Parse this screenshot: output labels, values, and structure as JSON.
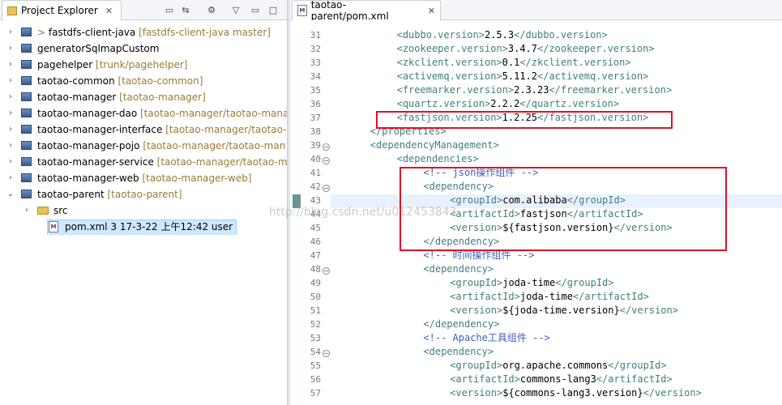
{
  "left_panel": {
    "tab_title": "Project Explorer",
    "items": [
      {
        "label": "fastdfs-client-java",
        "decoration": "[fastdfs-client-java master]",
        "prefix": ">",
        "type": "project",
        "expanded": false
      },
      {
        "label": "generatorSqlmapCustom",
        "decoration": "",
        "prefix": "",
        "type": "project",
        "expanded": false
      },
      {
        "label": "pagehelper",
        "decoration": "[trunk/pagehelper]",
        "prefix": "",
        "type": "project",
        "expanded": false
      },
      {
        "label": "taotao-common",
        "decoration": "[taotao-common]",
        "prefix": "",
        "type": "project",
        "expanded": false
      },
      {
        "label": "taotao-manager",
        "decoration": "[taotao-manager]",
        "prefix": "",
        "type": "project",
        "expanded": false
      },
      {
        "label": "taotao-manager-dao",
        "decoration": "[taotao-manager/taotao-mana",
        "prefix": "",
        "type": "project",
        "expanded": false
      },
      {
        "label": "taotao-manager-interface",
        "decoration": "[taotao-manager/taotao-m",
        "prefix": "",
        "type": "project",
        "expanded": false
      },
      {
        "label": "taotao-manager-pojo",
        "decoration": "[taotao-manager/taotao-man",
        "prefix": "",
        "type": "project",
        "expanded": false
      },
      {
        "label": "taotao-manager-service",
        "decoration": "[taotao-manager/taotao-m",
        "prefix": "",
        "type": "project",
        "expanded": false
      },
      {
        "label": "taotao-manager-web",
        "decoration": "[taotao-manager-web]",
        "prefix": "",
        "type": "project",
        "expanded": false
      },
      {
        "label": "taotao-parent",
        "decoration": "[taotao-parent]",
        "prefix": "",
        "type": "project",
        "expanded": true
      },
      {
        "label": "src",
        "decoration": "",
        "prefix": "",
        "type": "folder",
        "expanded": false
      },
      {
        "label": "pom.xml 3  17-3-22 上午12:42  user",
        "decoration": "",
        "prefix": "",
        "type": "xml",
        "selected": true
      }
    ]
  },
  "editor": {
    "tab_title": "taotao-parent/pom.xml",
    "current_line": 43,
    "lines": [
      {
        "n": "31",
        "indent": 8,
        "parts": [
          [
            "t",
            "<dubbo.version>"
          ],
          [
            "v",
            "2.5.3"
          ],
          [
            "t",
            "</dubbo.version>"
          ]
        ]
      },
      {
        "n": "32",
        "indent": 8,
        "parts": [
          [
            "t",
            "<zookeeper.version>"
          ],
          [
            "v",
            "3.4.7"
          ],
          [
            "t",
            "</zookeeper.version>"
          ]
        ]
      },
      {
        "n": "33",
        "indent": 8,
        "parts": [
          [
            "t",
            "<zkclient.version>"
          ],
          [
            "v",
            "0.1"
          ],
          [
            "t",
            "</zkclient.version>"
          ]
        ]
      },
      {
        "n": "34",
        "indent": 8,
        "parts": [
          [
            "t",
            "<activemq.version>"
          ],
          [
            "v",
            "5.11.2"
          ],
          [
            "t",
            "</activemq.version>"
          ]
        ]
      },
      {
        "n": "35",
        "indent": 8,
        "parts": [
          [
            "t",
            "<freemarker.version>"
          ],
          [
            "v",
            "2.3.23"
          ],
          [
            "t",
            "</freemarker.version>"
          ]
        ]
      },
      {
        "n": "36",
        "indent": 8,
        "parts": [
          [
            "t",
            "<quartz.version>"
          ],
          [
            "v",
            "2.2.2"
          ],
          [
            "t",
            "</quartz.version>"
          ]
        ]
      },
      {
        "n": "37",
        "indent": 8,
        "parts": [
          [
            "t",
            "<fastjson.version>"
          ],
          [
            "v",
            "1.2.25"
          ],
          [
            "t",
            "</fastjson.version>"
          ]
        ]
      },
      {
        "n": "38",
        "indent": 4,
        "parts": [
          [
            "t",
            "</properties>"
          ]
        ]
      },
      {
        "n": "39",
        "indent": 4,
        "fold": true,
        "parts": [
          [
            "t",
            "<dependencyManagement>"
          ]
        ]
      },
      {
        "n": "40",
        "indent": 8,
        "fold": true,
        "parts": [
          [
            "t",
            "<dependencies>"
          ]
        ]
      },
      {
        "n": "41",
        "indent": 12,
        "parts": [
          [
            "c",
            "<!-- json操作组件 -->"
          ]
        ]
      },
      {
        "n": "42",
        "indent": 12,
        "fold": true,
        "parts": [
          [
            "t",
            "<dependency>"
          ]
        ]
      },
      {
        "n": "43",
        "indent": 16,
        "parts": [
          [
            "t",
            "<groupId>"
          ],
          [
            "v",
            "com.alibaba"
          ],
          [
            "t",
            "</groupId>"
          ]
        ]
      },
      {
        "n": "44",
        "indent": 16,
        "parts": [
          [
            "t",
            "<artifactId>"
          ],
          [
            "v",
            "fastjson"
          ],
          [
            "t",
            "</artifactId>"
          ]
        ]
      },
      {
        "n": "45",
        "indent": 16,
        "parts": [
          [
            "t",
            "<version>"
          ],
          [
            "v",
            "${fastjson.version}"
          ],
          [
            "t",
            "</version>"
          ]
        ]
      },
      {
        "n": "46",
        "indent": 12,
        "parts": [
          [
            "t",
            "</dependency>"
          ]
        ]
      },
      {
        "n": "47",
        "indent": 12,
        "parts": [
          [
            "c",
            "<!-- 时间操作组件 -->"
          ]
        ]
      },
      {
        "n": "48",
        "indent": 12,
        "fold": true,
        "parts": [
          [
            "t",
            "<dependency>"
          ]
        ]
      },
      {
        "n": "49",
        "indent": 16,
        "parts": [
          [
            "t",
            "<groupId>"
          ],
          [
            "v",
            "joda-time"
          ],
          [
            "t",
            "</groupId>"
          ]
        ]
      },
      {
        "n": "50",
        "indent": 16,
        "parts": [
          [
            "t",
            "<artifactId>"
          ],
          [
            "v",
            "joda-time"
          ],
          [
            "t",
            "</artifactId>"
          ]
        ]
      },
      {
        "n": "51",
        "indent": 16,
        "parts": [
          [
            "t",
            "<version>"
          ],
          [
            "v",
            "${joda-time.version}"
          ],
          [
            "t",
            "</version>"
          ]
        ]
      },
      {
        "n": "52",
        "indent": 12,
        "parts": [
          [
            "t",
            "</dependency>"
          ]
        ]
      },
      {
        "n": "53",
        "indent": 12,
        "parts": [
          [
            "c",
            "<!-- Apache工具组件 -->"
          ]
        ]
      },
      {
        "n": "54",
        "indent": 12,
        "fold": true,
        "parts": [
          [
            "t",
            "<dependency>"
          ]
        ]
      },
      {
        "n": "55",
        "indent": 16,
        "parts": [
          [
            "t",
            "<groupId>"
          ],
          [
            "v",
            "org.apache.commons"
          ],
          [
            "t",
            "</groupId>"
          ]
        ]
      },
      {
        "n": "56",
        "indent": 16,
        "parts": [
          [
            "t",
            "<artifactId>"
          ],
          [
            "v",
            "commons-lang3"
          ],
          [
            "t",
            "</artifactId>"
          ]
        ]
      },
      {
        "n": "57",
        "indent": 16,
        "parts": [
          [
            "t",
            "<version>"
          ],
          [
            "v",
            "${commons-lang3.version}"
          ],
          [
            "t",
            "</version>"
          ]
        ]
      }
    ]
  },
  "watermark": "http://blog.csdn.net/u012453843",
  "colors": {
    "highlight": "#e0102a",
    "tag": "#3f7f7f",
    "comment": "#3f5fbf",
    "selection": "#cde8ff"
  }
}
